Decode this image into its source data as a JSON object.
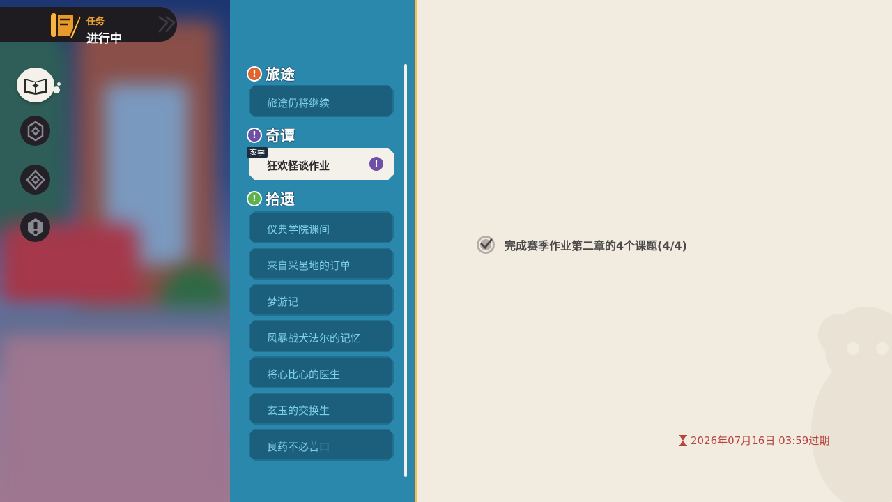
{
  "badge": {
    "sub_label": "任务",
    "main_label": "进行中"
  },
  "side_nav": {
    "icons": [
      "quest-book-icon",
      "emblem-icon-a",
      "emblem-icon-b",
      "exclamation-icon"
    ]
  },
  "quest_list": {
    "sections": [
      {
        "title": "旅途",
        "icon": "exclamation",
        "icon_color": "#e0652e",
        "items": [
          {
            "label": "旅途仍将继续",
            "active": false
          }
        ]
      },
      {
        "title": "奇谭",
        "icon": "exclamation",
        "icon_color": "#6f4fa6",
        "items": [
          {
            "label": "狂欢怪谈作业",
            "active": true,
            "tag": "亥季",
            "alert": "!"
          }
        ]
      },
      {
        "title": "拾遗",
        "icon": "exclamation",
        "icon_color": "#5cb34a",
        "items": [
          {
            "label": "仪典学院课间",
            "active": false
          },
          {
            "label": "来自采邑地的订单",
            "active": false
          },
          {
            "label": "梦游记",
            "active": false
          },
          {
            "label": "风暴战犬法尔的记忆",
            "active": false
          },
          {
            "label": "将心比心的医生",
            "active": false
          },
          {
            "label": "玄玉的交换生",
            "active": false
          },
          {
            "label": "良药不必苦口",
            "active": false
          }
        ]
      }
    ]
  },
  "detail": {
    "objective": {
      "text": "完成赛季作业第二章的4个课题(4/4)",
      "completed": true,
      "icon": "check-badge-icon"
    },
    "expiry": {
      "text": "2026年07月16日 03:59过期",
      "icon": "hourglass-icon",
      "color": "#b8423d"
    }
  },
  "colors": {
    "panel": "#2b88ad",
    "item": "#1c5f7c",
    "item_text": "#7fd0ea",
    "detail_bg": "#f1ebe0",
    "accent": "#f0c14b"
  }
}
